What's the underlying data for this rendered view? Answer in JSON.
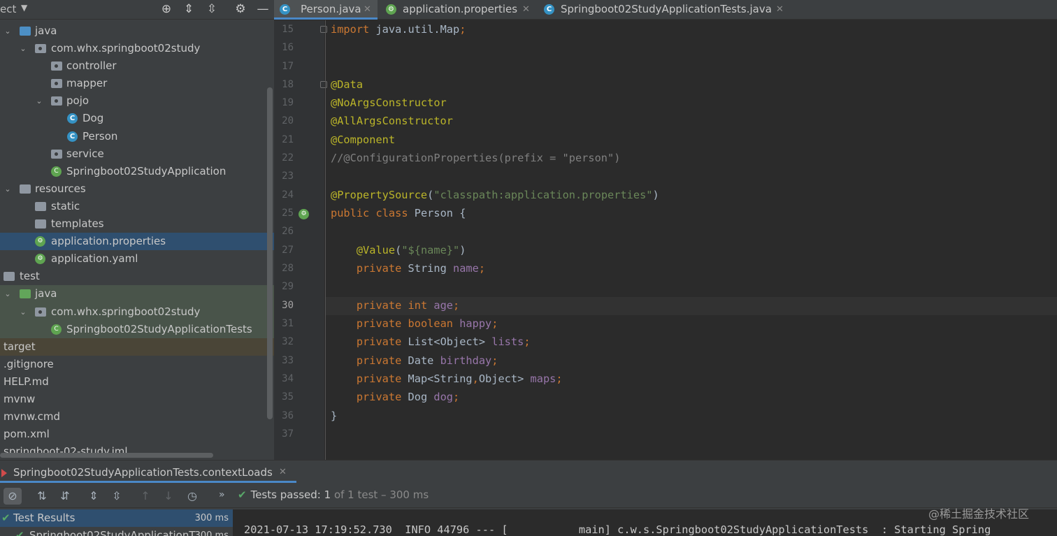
{
  "project_panel": {
    "title": "ect",
    "tree": [
      {
        "label": "java",
        "type": "folder-blue",
        "caret": "open"
      },
      {
        "label": "com.whx.springboot02study",
        "type": "package",
        "caret": "open"
      },
      {
        "label": "controller",
        "type": "package"
      },
      {
        "label": "mapper",
        "type": "package"
      },
      {
        "label": "pojo",
        "type": "package",
        "caret": "open"
      },
      {
        "label": "Dog",
        "type": "class"
      },
      {
        "label": "Person",
        "type": "class"
      },
      {
        "label": "service",
        "type": "package"
      },
      {
        "label": "Springboot02StudyApplication",
        "type": "spring-class"
      },
      {
        "label": "resources",
        "type": "folder",
        "caret": "open"
      },
      {
        "label": "static",
        "type": "folder"
      },
      {
        "label": "templates",
        "type": "folder"
      },
      {
        "label": "application.properties",
        "type": "spring-file",
        "selected": true
      },
      {
        "label": "application.yaml",
        "type": "spring-file"
      },
      {
        "label": "test",
        "type": "folder"
      },
      {
        "label": "java",
        "type": "folder-green",
        "caret": "open"
      },
      {
        "label": "com.whx.springboot02study",
        "type": "package",
        "caret": "open"
      },
      {
        "label": "Springboot02StudyApplicationTests",
        "type": "spring-class"
      },
      {
        "label": "target",
        "type": "folder-excluded"
      },
      {
        "label": ".gitignore",
        "type": "file"
      },
      {
        "label": "HELP.md",
        "type": "file"
      },
      {
        "label": "mvnw",
        "type": "file"
      },
      {
        "label": "mvnw.cmd",
        "type": "file"
      },
      {
        "label": "pom.xml",
        "type": "file"
      },
      {
        "label": "springboot-02-study.iml",
        "type": "file"
      }
    ]
  },
  "editor_tabs": [
    {
      "label": "Person.java",
      "icon": "class-icon",
      "active": true
    },
    {
      "label": "application.properties",
      "icon": "spring-icon",
      "active": false
    },
    {
      "label": "Springboot02StudyApplicationTests.java",
      "icon": "class-icon",
      "active": false
    }
  ],
  "editor": {
    "current_line": 30,
    "line_numbers": [
      "15",
      "16",
      "17",
      "18",
      "19",
      "20",
      "21",
      "22",
      "23",
      "24",
      "25",
      "26",
      "27",
      "28",
      "29",
      "30",
      "31",
      "32",
      "33",
      "34",
      "35",
      "36",
      "37"
    ],
    "lines": [
      "import java.util.Map;",
      "",
      "",
      "@Data",
      "@NoArgsConstructor",
      "@AllArgsConstructor",
      "@Component",
      "//@ConfigurationProperties(prefix = \"person\")",
      "",
      "@PropertySource(\"classpath:application.properties\")",
      "public class Person {",
      "",
      "    @Value(\"${name}\")",
      "    private String name;",
      "",
      "    private int age;",
      "    private boolean happy;",
      "    private List<Object> lists;",
      "    private Date birthday;",
      "    private Map<String,Object> maps;",
      "    private Dog dog;",
      "}",
      ""
    ]
  },
  "run_window": {
    "tab_label": "Springboot02StudyApplicationTests.contextLoads",
    "status_prefix": "Tests passed: ",
    "status_count": "1",
    "status_suffix": " of 1 test – 300 ms",
    "results": [
      {
        "label": "Test Results",
        "time": "300 ms",
        "selected": true
      },
      {
        "label": "Springboot02StudyApplicationT",
        "time": "300 ms",
        "selected": false
      }
    ],
    "console_line": "2021-07-13 17:19:52.730  INFO 44796 --- [           main] c.w.s.Springboot02StudyApplicationTests  : Starting Spring"
  },
  "watermark": "@稀土掘金技术社区",
  "colors": {
    "keyword": "#cc7832",
    "annotation": "#bbb529",
    "string": "#6a8759",
    "field": "#9876aa",
    "comment": "#808080",
    "selection": "#2f4f6f",
    "accent": "#4a88c7",
    "pass": "#59a869"
  }
}
